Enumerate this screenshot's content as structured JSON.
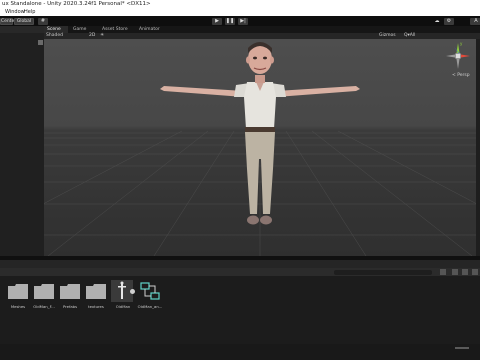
{
  "window": {
    "title": "ux Standalone - Unity 2020.3.24f1 Personal* <DX11>"
  },
  "menu": {
    "items": [
      "Window",
      "Help"
    ]
  },
  "toolbar": {
    "center_label": "Center",
    "global_label": "Global"
  },
  "scene_tabs": [
    {
      "label": "Scene"
    },
    {
      "label": "Game"
    },
    {
      "label": "Asset Store"
    },
    {
      "label": "Animator"
    }
  ],
  "scene_toolbar": {
    "shading_mode": "Shaded",
    "mode_2d": "2D",
    "gizmos_label": "Gizmos",
    "search_prefix": "Q▾All"
  },
  "gizmo": {
    "projection_label": "< Persp"
  },
  "project": {
    "assets": [
      {
        "label": "Meshes",
        "type": "folder"
      },
      {
        "label": "OldMan_F...",
        "type": "folder"
      },
      {
        "label": "Prefabs",
        "type": "folder"
      },
      {
        "label": "textures",
        "type": "folder"
      },
      {
        "label": "OldMan",
        "type": "model"
      },
      {
        "label": "OldMan_an...",
        "type": "animator"
      }
    ]
  },
  "colors": {
    "viewport_bg": "#474747",
    "toolbar_bg": "#0e0e0e",
    "gizmo_y": "#8fcc3d",
    "gizmo_x": "#e24a3b",
    "gizmo_z": "#3b74e2"
  }
}
